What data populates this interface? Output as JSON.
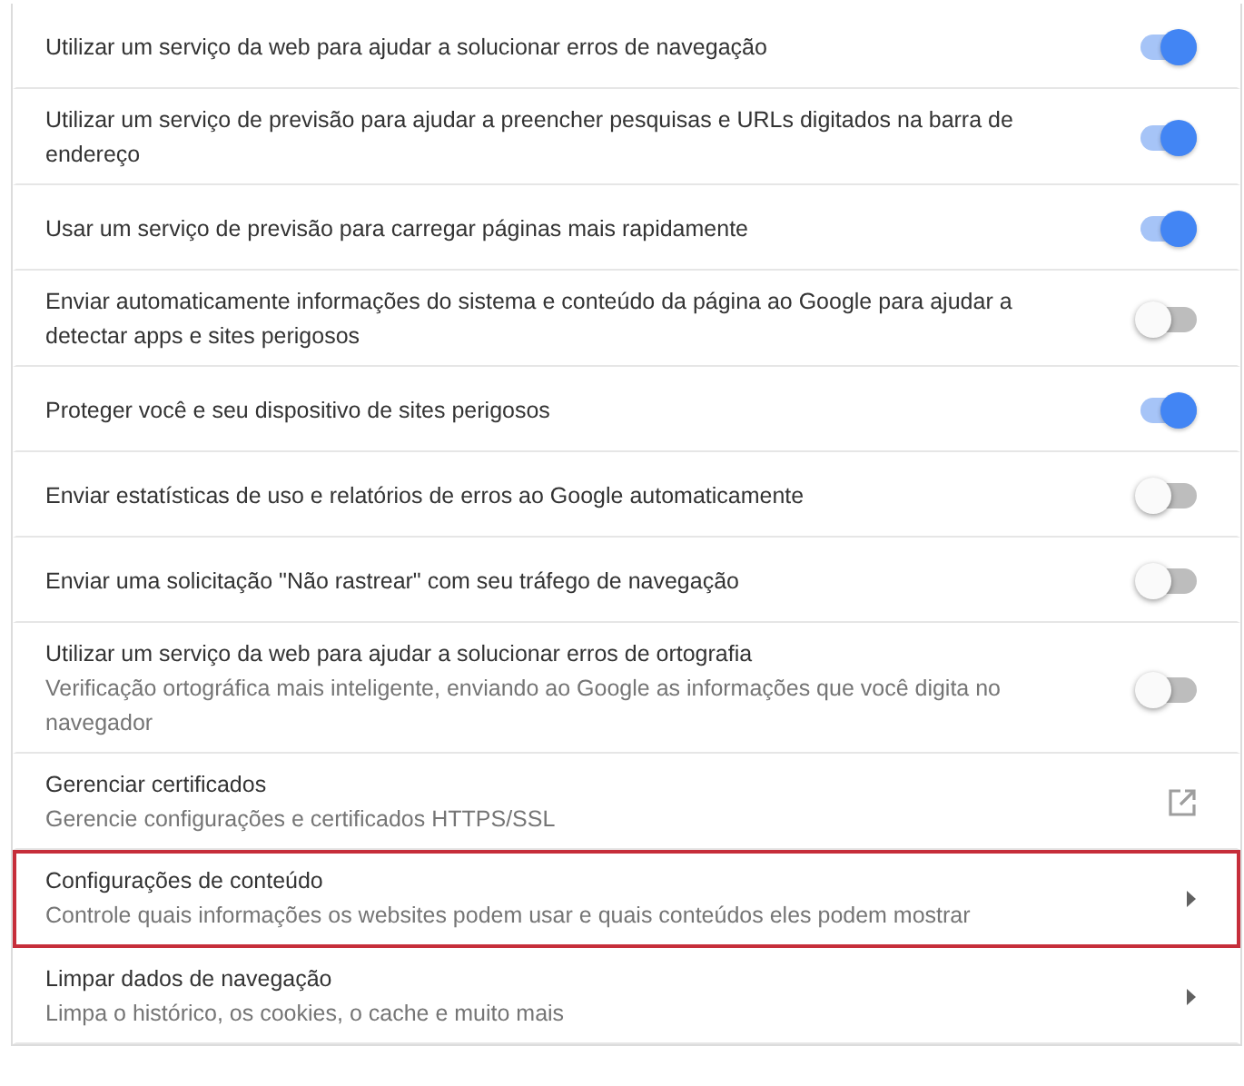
{
  "rows": [
    {
      "kind": "toggle",
      "title": "Utilizar um serviço da web para ajudar a solucionar erros de navegação",
      "on": true,
      "highlighted": false
    },
    {
      "kind": "toggle",
      "title": "Utilizar um serviço de previsão para ajudar a preencher pesquisas e URLs digitados na barra de endereço",
      "on": true,
      "highlighted": false
    },
    {
      "kind": "toggle",
      "title": "Usar um serviço de previsão para carregar páginas mais rapidamente",
      "on": true,
      "highlighted": false
    },
    {
      "kind": "toggle",
      "title": "Enviar automaticamente informações do sistema e conteúdo da página ao Google para ajudar a detectar apps e sites perigosos",
      "on": false,
      "highlighted": false
    },
    {
      "kind": "toggle",
      "title": "Proteger você e seu dispositivo de sites perigosos",
      "on": true,
      "highlighted": false
    },
    {
      "kind": "toggle",
      "title": "Enviar estatísticas de uso e relatórios de erros ao Google automaticamente",
      "on": false,
      "highlighted": false
    },
    {
      "kind": "toggle",
      "title": "Enviar uma solicitação \"Não rastrear\" com seu tráfego de navegação",
      "on": false,
      "highlighted": false
    },
    {
      "kind": "toggle",
      "title": "Utilizar um serviço da web para ajudar a solucionar erros de ortografia",
      "subtitle": "Verificação ortográfica mais inteligente, enviando ao Google as informações que você digita no navegador",
      "on": false,
      "highlighted": false
    },
    {
      "kind": "external",
      "title": "Gerenciar certificados",
      "subtitle": "Gerencie configurações e certificados HTTPS/SSL",
      "highlighted": false
    },
    {
      "kind": "arrow",
      "title": "Configurações de conteúdo",
      "subtitle": "Controle quais informações os websites podem usar e quais conteúdos eles podem mostrar",
      "highlighted": true
    },
    {
      "kind": "arrow",
      "title": "Limpar dados de navegação",
      "subtitle": "Limpa o histórico, os cookies, o cache e muito mais",
      "highlighted": false
    }
  ]
}
